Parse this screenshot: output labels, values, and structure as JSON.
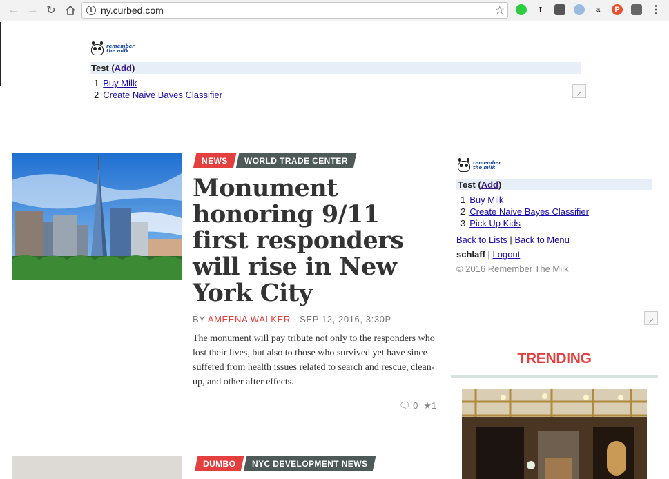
{
  "browser": {
    "url": "ny.curbed.com",
    "info_icon": "i"
  },
  "rtm_top": {
    "logo_text_1": "remember",
    "logo_text_2": "the milk",
    "list_name": "Test (",
    "add_label": "Add",
    "close_paren": ")",
    "items": [
      {
        "num": "1",
        "label": "Buy Milk"
      },
      {
        "num": "2",
        "label": "Create Naive Bayes Classifier"
      }
    ]
  },
  "rtm_side": {
    "logo_text_1": "remember",
    "logo_text_2": "the milk",
    "list_name": "Test (",
    "add_label": "Add",
    "close_paren": ")",
    "items": [
      {
        "num": "1",
        "label": "Buy Milk"
      },
      {
        "num": "2",
        "label": "Create Naive Bayes Classifier"
      },
      {
        "num": "3",
        "label": "Pick Up Kids"
      }
    ],
    "back_to_lists": "Back to Lists",
    "separator": "|",
    "back_to_menu": "Back to Menu",
    "username": "schlaff",
    "logout": "Logout",
    "copyright": "© 2016 Remember The Milk"
  },
  "article": {
    "tags": [
      "NEWS",
      "WORLD TRADE CENTER"
    ],
    "headline": "Monument honoring 9/11 first responders will rise in New York City",
    "by": "BY",
    "author": "AMEENA WALKER",
    "date": "· SEP 12, 2016, 3:30P",
    "dek": "The monument will pay tribute not only to the responders who lost their lives, but also to those who survived yet have since suffered from health issues related to search and rescue, clean-up, and other after effects.",
    "comments": "0",
    "stars": "1"
  },
  "next_article": {
    "tags": [
      "DUMBO",
      "NYC DEVELOPMENT NEWS"
    ]
  },
  "trending": {
    "title": "TRENDING"
  },
  "colors": {
    "accent_red": "#e43f3f",
    "tag_gray": "#4d5a57",
    "link_blue": "#1a0dab"
  }
}
